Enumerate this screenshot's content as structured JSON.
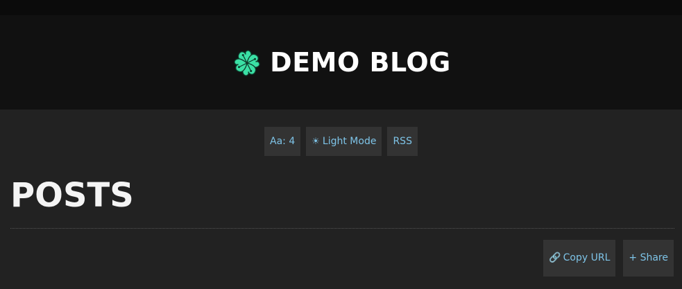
{
  "site": {
    "title": "DEMO BLOG",
    "logo_icon": "four-leaf-clover-icon",
    "logo_color": "#3be0a5"
  },
  "toolbar": {
    "font_size_label": "Aa: 4",
    "light_mode_icon": "sun-icon",
    "light_mode_label": "Light Mode",
    "rss_label": "RSS"
  },
  "page": {
    "heading": "POSTS"
  },
  "actions": {
    "copy_url_icon": "link-icon",
    "copy_url_label": "Copy URL",
    "share_icon": "plus-icon",
    "share_label": "+ Share"
  },
  "colors": {
    "background": "#222222",
    "header_background": "#111111",
    "button_background": "#333333",
    "link_text": "#7ec4e8",
    "accent_green": "#3be0a5"
  }
}
